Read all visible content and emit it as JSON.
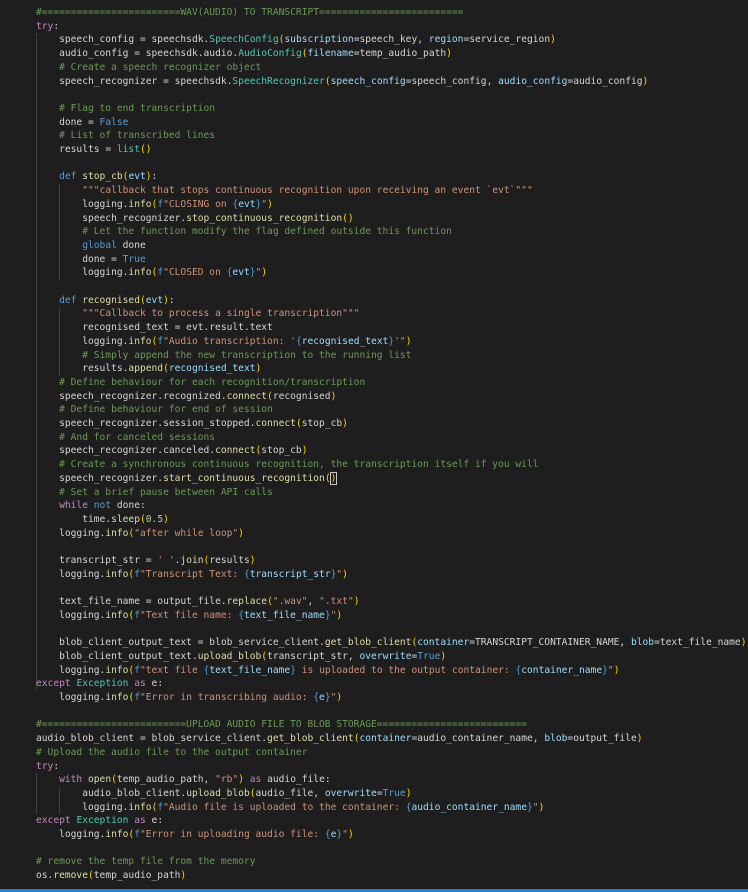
{
  "editor": {
    "language": "python",
    "cursor_line": 34,
    "lines": [
      [
        [
          "#========================WAV(AUDIO) TO TRANSCRIPT=========================",
          "cm"
        ]
      ],
      [
        [
          "try",
          "kc"
        ],
        [
          ":",
          "pl"
        ]
      ],
      [
        [
          "    speech_config ",
          "pl"
        ],
        [
          "=",
          "pl"
        ],
        [
          " speechsdk.",
          "pl"
        ],
        [
          "SpeechConfig",
          "cls"
        ],
        [
          "(",
          "br1"
        ],
        [
          "subscription",
          "var"
        ],
        [
          "=speech_key, ",
          "pl"
        ],
        [
          "region",
          "var"
        ],
        [
          "=service_region",
          "pl"
        ],
        [
          ")",
          "br1"
        ]
      ],
      [
        [
          "    audio_config ",
          "pl"
        ],
        [
          "=",
          "pl"
        ],
        [
          " speechsdk.audio.",
          "pl"
        ],
        [
          "AudioConfig",
          "cls"
        ],
        [
          "(",
          "br1"
        ],
        [
          "filename",
          "var"
        ],
        [
          "=temp_audio_path",
          "pl"
        ],
        [
          ")",
          "br1"
        ]
      ],
      [
        [
          "    # Create a speech recognizer object",
          "cm"
        ]
      ],
      [
        [
          "    speech_recognizer ",
          "pl"
        ],
        [
          "=",
          "pl"
        ],
        [
          " speechsdk.",
          "pl"
        ],
        [
          "SpeechRecognizer",
          "cls"
        ],
        [
          "(",
          "br1"
        ],
        [
          "speech_config",
          "var"
        ],
        [
          "=speech_config, ",
          "pl"
        ],
        [
          "audio_config",
          "var"
        ],
        [
          "=audio_config",
          "pl"
        ],
        [
          ")",
          "br1"
        ]
      ],
      [],
      [
        [
          "    # Flag to end transcription",
          "cm"
        ]
      ],
      [
        [
          "    done ",
          "pl"
        ],
        [
          "=",
          "pl"
        ],
        [
          " False",
          "kw"
        ]
      ],
      [
        [
          "    # List of transcribed lines",
          "cm"
        ]
      ],
      [
        [
          "    results ",
          "pl"
        ],
        [
          "=",
          "pl"
        ],
        [
          " ",
          "pl"
        ],
        [
          "list",
          "cls"
        ],
        [
          "()",
          "br1"
        ]
      ],
      [],
      [
        [
          "    ",
          "pl"
        ],
        [
          "def",
          "kw"
        ],
        [
          " ",
          "pl"
        ],
        [
          "stop_cb",
          "fn"
        ],
        [
          "(",
          "br1"
        ],
        [
          "evt",
          "var"
        ],
        [
          ")",
          "br1"
        ],
        [
          ":",
          "pl"
        ]
      ],
      [
        [
          "        ",
          "pl"
        ],
        [
          "\"\"\"callback that stops continuous recognition upon receiving an event `evt`\"\"\"",
          "st"
        ]
      ],
      [
        [
          "        logging.",
          "pl"
        ],
        [
          "info",
          "fn"
        ],
        [
          "(",
          "br1"
        ],
        [
          "f",
          "kw"
        ],
        [
          "\"CLOSING on ",
          "st"
        ],
        [
          "{",
          "kw"
        ],
        [
          "evt",
          "var"
        ],
        [
          "}",
          "kw"
        ],
        [
          "\"",
          "st"
        ],
        [
          ")",
          "br1"
        ]
      ],
      [
        [
          "        speech_recognizer.",
          "pl"
        ],
        [
          "stop_continuous_recognition",
          "fn"
        ],
        [
          "()",
          "br1"
        ]
      ],
      [
        [
          "        # Let the function modify the flag defined outside this function",
          "cm"
        ]
      ],
      [
        [
          "        ",
          "pl"
        ],
        [
          "global",
          "kw"
        ],
        [
          " done",
          "pl"
        ]
      ],
      [
        [
          "        done ",
          "pl"
        ],
        [
          "=",
          "pl"
        ],
        [
          " True",
          "kw"
        ]
      ],
      [
        [
          "        logging.",
          "pl"
        ],
        [
          "info",
          "fn"
        ],
        [
          "(",
          "br1"
        ],
        [
          "f",
          "kw"
        ],
        [
          "\"CLOSED on ",
          "st"
        ],
        [
          "{",
          "kw"
        ],
        [
          "evt",
          "var"
        ],
        [
          "}",
          "kw"
        ],
        [
          "\"",
          "st"
        ],
        [
          ")",
          "br1"
        ]
      ],
      [],
      [
        [
          "    ",
          "pl"
        ],
        [
          "def",
          "kw"
        ],
        [
          " ",
          "pl"
        ],
        [
          "recognised",
          "fn"
        ],
        [
          "(",
          "br1"
        ],
        [
          "evt",
          "var"
        ],
        [
          ")",
          "br1"
        ],
        [
          ":",
          "pl"
        ]
      ],
      [
        [
          "        ",
          "pl"
        ],
        [
          "\"\"\"Callback to process a single transcription\"\"\"",
          "st"
        ]
      ],
      [
        [
          "        recognised_text ",
          "pl"
        ],
        [
          "=",
          "pl"
        ],
        [
          " evt.result.text",
          "pl"
        ]
      ],
      [
        [
          "        logging.",
          "pl"
        ],
        [
          "info",
          "fn"
        ],
        [
          "(",
          "br1"
        ],
        [
          "f",
          "kw"
        ],
        [
          "\"Audio transcription: '",
          "st"
        ],
        [
          "{",
          "kw"
        ],
        [
          "recognised_text",
          "var"
        ],
        [
          "}",
          "kw"
        ],
        [
          "'\"",
          "st"
        ],
        [
          ")",
          "br1"
        ]
      ],
      [
        [
          "        # Simply append the new transcription to the running list",
          "cm"
        ]
      ],
      [
        [
          "        results.",
          "pl"
        ],
        [
          "append",
          "fn"
        ],
        [
          "(",
          "br1"
        ],
        [
          "recognised_text",
          "var"
        ],
        [
          ")",
          "br1"
        ]
      ],
      [
        [
          "    # Define behaviour for each recognition/transcription",
          "cm"
        ]
      ],
      [
        [
          "    speech_recognizer.recognized.",
          "pl"
        ],
        [
          "connect",
          "fn"
        ],
        [
          "(",
          "br1"
        ],
        [
          "recognised",
          "pl"
        ],
        [
          ")",
          "br1"
        ]
      ],
      [
        [
          "    # Define behaviour for end of session",
          "cm"
        ]
      ],
      [
        [
          "    speech_recognizer.session_stopped.",
          "pl"
        ],
        [
          "connect",
          "fn"
        ],
        [
          "(",
          "br1"
        ],
        [
          "stop_cb",
          "pl"
        ],
        [
          ")",
          "br1"
        ]
      ],
      [
        [
          "    # And for canceled sessions",
          "cm"
        ]
      ],
      [
        [
          "    speech_recognizer.canceled.",
          "pl"
        ],
        [
          "connect",
          "fn"
        ],
        [
          "(",
          "br1"
        ],
        [
          "stop_cb",
          "pl"
        ],
        [
          ")",
          "br1"
        ]
      ],
      [
        [
          "    # Create a synchronous continuous recognition, the transcription itself if you will",
          "cm"
        ]
      ],
      [
        [
          "    speech_recognizer.",
          "pl"
        ],
        [
          "start_continuous_recognition",
          "fn"
        ],
        [
          "(",
          "br1"
        ],
        [
          ")",
          "br1"
        ]
      ],
      [
        [
          "    # Set a brief pause between API calls",
          "cm"
        ]
      ],
      [
        [
          "    ",
          "pl"
        ],
        [
          "while",
          "kc"
        ],
        [
          " ",
          "pl"
        ],
        [
          "not",
          "kw"
        ],
        [
          " done:",
          "pl"
        ]
      ],
      [
        [
          "        time.",
          "pl"
        ],
        [
          "sleep",
          "fn"
        ],
        [
          "(",
          "br1"
        ],
        [
          "0.5",
          "nm"
        ],
        [
          ")",
          "br1"
        ]
      ],
      [
        [
          "    logging.",
          "pl"
        ],
        [
          "info",
          "fn"
        ],
        [
          "(",
          "br1"
        ],
        [
          "\"after while loop\"",
          "st"
        ],
        [
          ")",
          "br1"
        ]
      ],
      [],
      [
        [
          "    transcript_str ",
          "pl"
        ],
        [
          "=",
          "pl"
        ],
        [
          " ",
          "pl"
        ],
        [
          "' '",
          "st"
        ],
        [
          ".",
          "pl"
        ],
        [
          "join",
          "fn"
        ],
        [
          "(",
          "br1"
        ],
        [
          "results",
          "pl"
        ],
        [
          ")",
          "br1"
        ]
      ],
      [
        [
          "    logging.",
          "pl"
        ],
        [
          "info",
          "fn"
        ],
        [
          "(",
          "br1"
        ],
        [
          "f",
          "kw"
        ],
        [
          "\"Transcript Text: ",
          "st"
        ],
        [
          "{",
          "kw"
        ],
        [
          "transcript_str",
          "var"
        ],
        [
          "}",
          "kw"
        ],
        [
          "\"",
          "st"
        ],
        [
          ")",
          "br1"
        ]
      ],
      [],
      [
        [
          "    text_file_name ",
          "pl"
        ],
        [
          "=",
          "pl"
        ],
        [
          " output_file.",
          "pl"
        ],
        [
          "replace",
          "fn"
        ],
        [
          "(",
          "br1"
        ],
        [
          "\".wav\"",
          "st"
        ],
        [
          ", ",
          "pl"
        ],
        [
          "\".txt\"",
          "st"
        ],
        [
          ")",
          "br1"
        ]
      ],
      [
        [
          "    logging.",
          "pl"
        ],
        [
          "info",
          "fn"
        ],
        [
          "(",
          "br1"
        ],
        [
          "f",
          "kw"
        ],
        [
          "\"Text file name: ",
          "st"
        ],
        [
          "{",
          "kw"
        ],
        [
          "text_file_name",
          "var"
        ],
        [
          "}",
          "kw"
        ],
        [
          "\"",
          "st"
        ],
        [
          ")",
          "br1"
        ]
      ],
      [],
      [
        [
          "    blob_client_output_text ",
          "pl"
        ],
        [
          "=",
          "pl"
        ],
        [
          " blob_service_client.",
          "pl"
        ],
        [
          "get_blob_client",
          "fn"
        ],
        [
          "(",
          "br1"
        ],
        [
          "container",
          "var"
        ],
        [
          "=TRANSCRIPT_CONTAINER_NAME, ",
          "pl"
        ],
        [
          "blob",
          "var"
        ],
        [
          "=text_file_name",
          "pl"
        ],
        [
          ")",
          "br1"
        ]
      ],
      [
        [
          "    blob_client_output_text.",
          "pl"
        ],
        [
          "upload_blob",
          "fn"
        ],
        [
          "(",
          "br1"
        ],
        [
          "transcript_str, ",
          "pl"
        ],
        [
          "overwrite",
          "var"
        ],
        [
          "=",
          "pl"
        ],
        [
          "True",
          "kw"
        ],
        [
          ")",
          "br1"
        ]
      ],
      [
        [
          "    logging.",
          "pl"
        ],
        [
          "info",
          "fn"
        ],
        [
          "(",
          "br1"
        ],
        [
          "f",
          "kw"
        ],
        [
          "\"text file ",
          "st"
        ],
        [
          "{",
          "kw"
        ],
        [
          "text_file_name",
          "var"
        ],
        [
          "}",
          "kw"
        ],
        [
          " is uploaded to the output container: ",
          "st"
        ],
        [
          "{",
          "kw"
        ],
        [
          "container_name",
          "var"
        ],
        [
          "}",
          "kw"
        ],
        [
          "\"",
          "st"
        ],
        [
          ")",
          "br1"
        ]
      ],
      [
        [
          "except",
          "kc"
        ],
        [
          " ",
          "pl"
        ],
        [
          "Exception",
          "cls"
        ],
        [
          " ",
          "pl"
        ],
        [
          "as",
          "kc"
        ],
        [
          " e:",
          "pl"
        ]
      ],
      [
        [
          "    logging.",
          "pl"
        ],
        [
          "info",
          "fn"
        ],
        [
          "(",
          "br1"
        ],
        [
          "f",
          "kw"
        ],
        [
          "\"Error in transcribing audio: ",
          "st"
        ],
        [
          "{",
          "kw"
        ],
        [
          "e",
          "var"
        ],
        [
          "}",
          "kw"
        ],
        [
          "\"",
          "st"
        ],
        [
          ")",
          "br1"
        ]
      ],
      [],
      [
        [
          "#=========================UPLOAD AUDIO FILE TO BLOB STORAGE==========================",
          "cm"
        ]
      ],
      [
        [
          "audio_blob_client ",
          "pl"
        ],
        [
          "=",
          "pl"
        ],
        [
          " blob_service_client.",
          "pl"
        ],
        [
          "get_blob_client",
          "fn"
        ],
        [
          "(",
          "br1"
        ],
        [
          "container",
          "var"
        ],
        [
          "=audio_container_name, ",
          "pl"
        ],
        [
          "blob",
          "var"
        ],
        [
          "=output_file",
          "pl"
        ],
        [
          ")",
          "br1"
        ]
      ],
      [
        [
          "# Upload the audio file to the output container",
          "cm"
        ]
      ],
      [
        [
          "try",
          "kc"
        ],
        [
          ":",
          "pl"
        ]
      ],
      [
        [
          "    ",
          "pl"
        ],
        [
          "with",
          "kc"
        ],
        [
          " ",
          "pl"
        ],
        [
          "open",
          "fn"
        ],
        [
          "(",
          "br1"
        ],
        [
          "temp_audio_path, ",
          "pl"
        ],
        [
          "\"rb\"",
          "st"
        ],
        [
          ")",
          "br1"
        ],
        [
          " ",
          "pl"
        ],
        [
          "as",
          "kc"
        ],
        [
          " audio_file:",
          "pl"
        ]
      ],
      [
        [
          "        audio_blob_client.",
          "pl"
        ],
        [
          "upload_blob",
          "fn"
        ],
        [
          "(",
          "br1"
        ],
        [
          "audio_file, ",
          "pl"
        ],
        [
          "overwrite",
          "var"
        ],
        [
          "=",
          "pl"
        ],
        [
          "True",
          "kw"
        ],
        [
          ")",
          "br1"
        ]
      ],
      [
        [
          "        logging.",
          "pl"
        ],
        [
          "info",
          "fn"
        ],
        [
          "(",
          "br1"
        ],
        [
          "f",
          "kw"
        ],
        [
          "\"Audio file is uploaded to the container: ",
          "st"
        ],
        [
          "{",
          "kw"
        ],
        [
          "audio_container_name",
          "var"
        ],
        [
          "}",
          "kw"
        ],
        [
          "\"",
          "st"
        ],
        [
          ")",
          "br1"
        ]
      ],
      [
        [
          "except",
          "kc"
        ],
        [
          " ",
          "pl"
        ],
        [
          "Exception",
          "cls"
        ],
        [
          " ",
          "pl"
        ],
        [
          "as",
          "kc"
        ],
        [
          " e:",
          "pl"
        ]
      ],
      [
        [
          "    logging.",
          "pl"
        ],
        [
          "info",
          "fn"
        ],
        [
          "(",
          "br1"
        ],
        [
          "f",
          "kw"
        ],
        [
          "\"Error in uploading audio file: ",
          "st"
        ],
        [
          "{",
          "kw"
        ],
        [
          "e",
          "var"
        ],
        [
          "}",
          "kw"
        ],
        [
          "\"",
          "st"
        ],
        [
          ")",
          "br1"
        ]
      ],
      [],
      [
        [
          "# remove the temp file from the memory",
          "cm"
        ]
      ],
      [
        [
          "os.",
          "pl"
        ],
        [
          "remove",
          "fn"
        ],
        [
          "(",
          "br1"
        ],
        [
          "temp_audio_path",
          "pl"
        ],
        [
          ")",
          "br1"
        ]
      ]
    ]
  }
}
